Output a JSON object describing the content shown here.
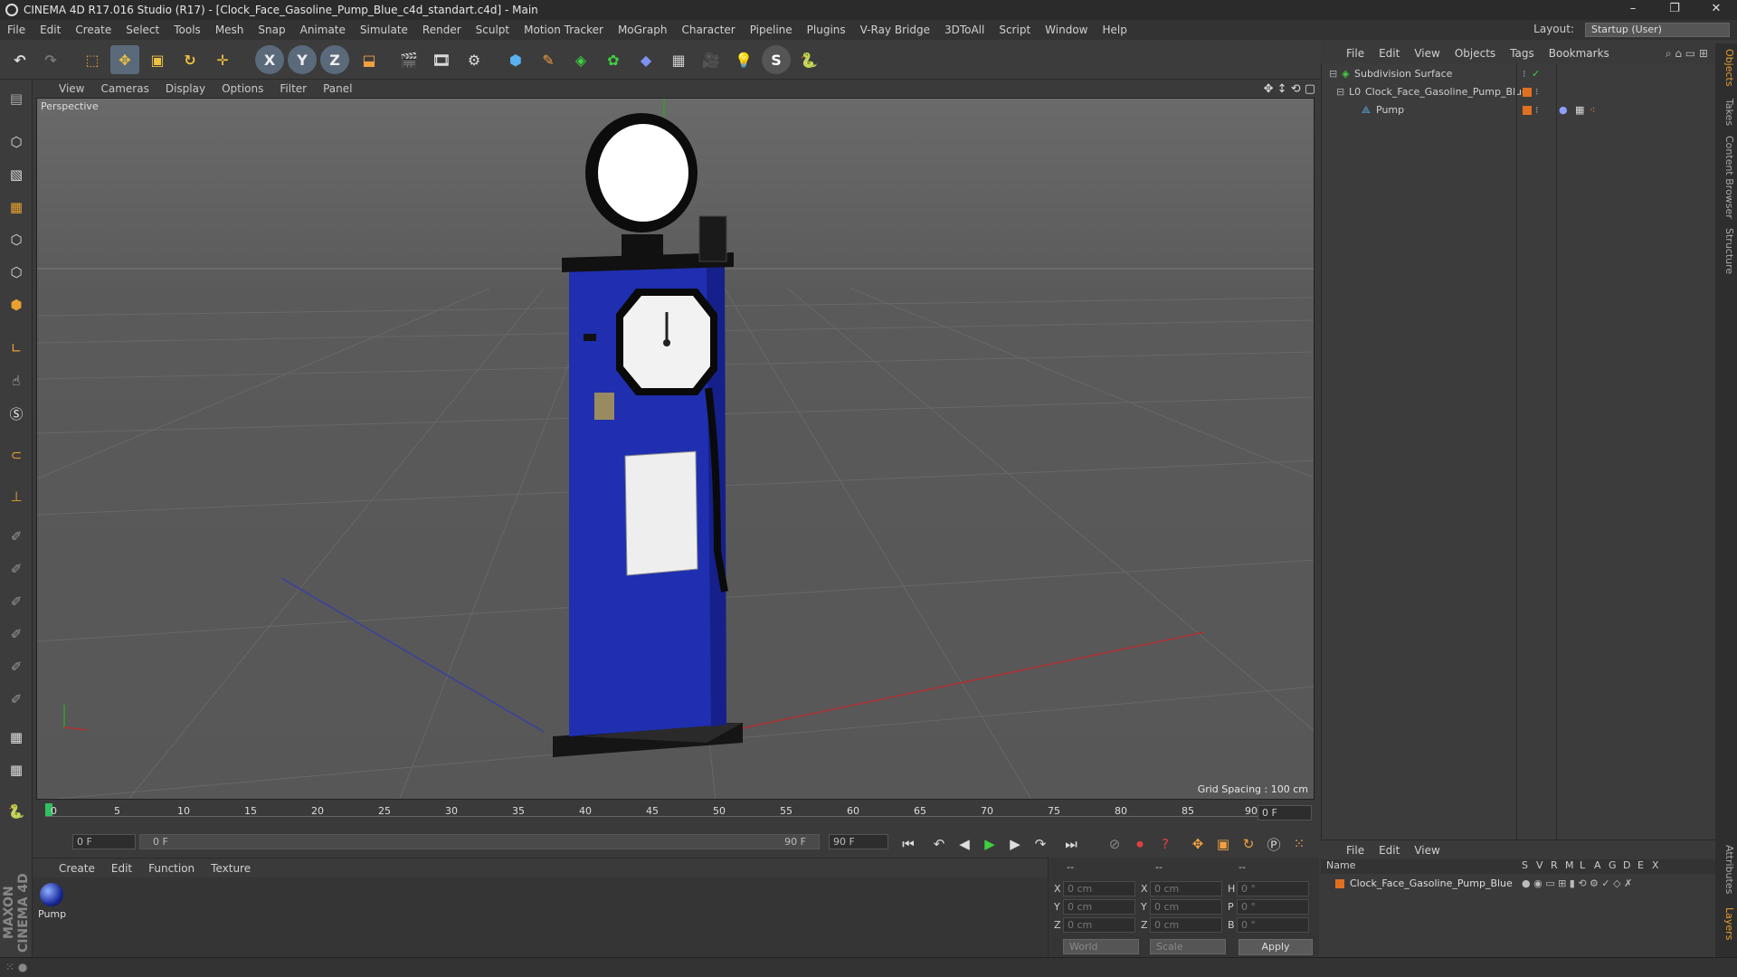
{
  "window": {
    "title": "CINEMA 4D R17.016 Studio (R17) - [Clock_Face_Gasoline_Pump_Blue_c4d_standart.c4d] - Main",
    "controls": [
      "–",
      "❐",
      "✕"
    ]
  },
  "menubar": {
    "items": [
      "File",
      "Edit",
      "Create",
      "Select",
      "Tools",
      "Mesh",
      "Snap",
      "Animate",
      "Simulate",
      "Render",
      "Sculpt",
      "Motion Tracker",
      "MoGraph",
      "Character",
      "Pipeline",
      "Plugins",
      "V-Ray Bridge",
      "3DToAll",
      "Script",
      "Window",
      "Help"
    ],
    "layout_label": "Layout:",
    "layout_value": "Startup (User)"
  },
  "toolbar": {
    "axis_x": "X",
    "axis_y": "Y",
    "axis_z": "Z"
  },
  "viewport": {
    "menu": [
      "View",
      "Cameras",
      "Display",
      "Options",
      "Filter",
      "Panel"
    ],
    "label": "Perspective",
    "grid_spacing": "Grid Spacing : 100 cm"
  },
  "timeline": {
    "ticks": [
      "0",
      "5",
      "10",
      "15",
      "20",
      "25",
      "30",
      "35",
      "40",
      "45",
      "50",
      "55",
      "60",
      "65",
      "70",
      "75",
      "80",
      "85",
      "90"
    ],
    "current_frame": "0 F"
  },
  "transport": {
    "start_field": "0 F",
    "range_start": "0 F",
    "range_end": "90 F",
    "end_field": "90 F"
  },
  "material_manager": {
    "menu": [
      "Create",
      "Edit",
      "Function",
      "Texture"
    ],
    "material_name": "Pump"
  },
  "coordinates": {
    "header": [
      "--",
      "--",
      "--"
    ],
    "rows": [
      {
        "pos_label": "X",
        "pos": "0 cm",
        "size_label": "X",
        "size": "0 cm",
        "rot_label": "H",
        "rot": "0 °"
      },
      {
        "pos_label": "Y",
        "pos": "0 cm",
        "size_label": "Y",
        "size": "0 cm",
        "rot_label": "P",
        "rot": "0 °"
      },
      {
        "pos_label": "Z",
        "pos": "0 cm",
        "size_label": "Z",
        "size": "0 cm",
        "rot_label": "B",
        "rot": "0 °"
      }
    ],
    "space": "World",
    "mode": "Scale",
    "apply": "Apply"
  },
  "object_manager": {
    "menu": [
      "File",
      "Edit",
      "View",
      "Objects",
      "Tags",
      "Bookmarks"
    ],
    "objects": [
      {
        "name": "Subdivision Surface",
        "indent": 0
      },
      {
        "name": "Clock_Face_Gasoline_Pump_Blue",
        "indent": 1
      },
      {
        "name": "Pump",
        "indent": 2
      }
    ]
  },
  "layer_manager": {
    "menu": [
      "File",
      "Edit",
      "View"
    ],
    "columns": [
      "Name",
      "S",
      "V",
      "R",
      "M",
      "L",
      "A",
      "G",
      "D",
      "E",
      "X"
    ],
    "layer_name": "Clock_Face_Gasoline_Pump_Blue"
  },
  "right_tabs": [
    "Objects",
    "Takes",
    "Content Browser",
    "Structure",
    "Attributes",
    "Layers"
  ],
  "branding": "MAXON CINEMA 4D"
}
